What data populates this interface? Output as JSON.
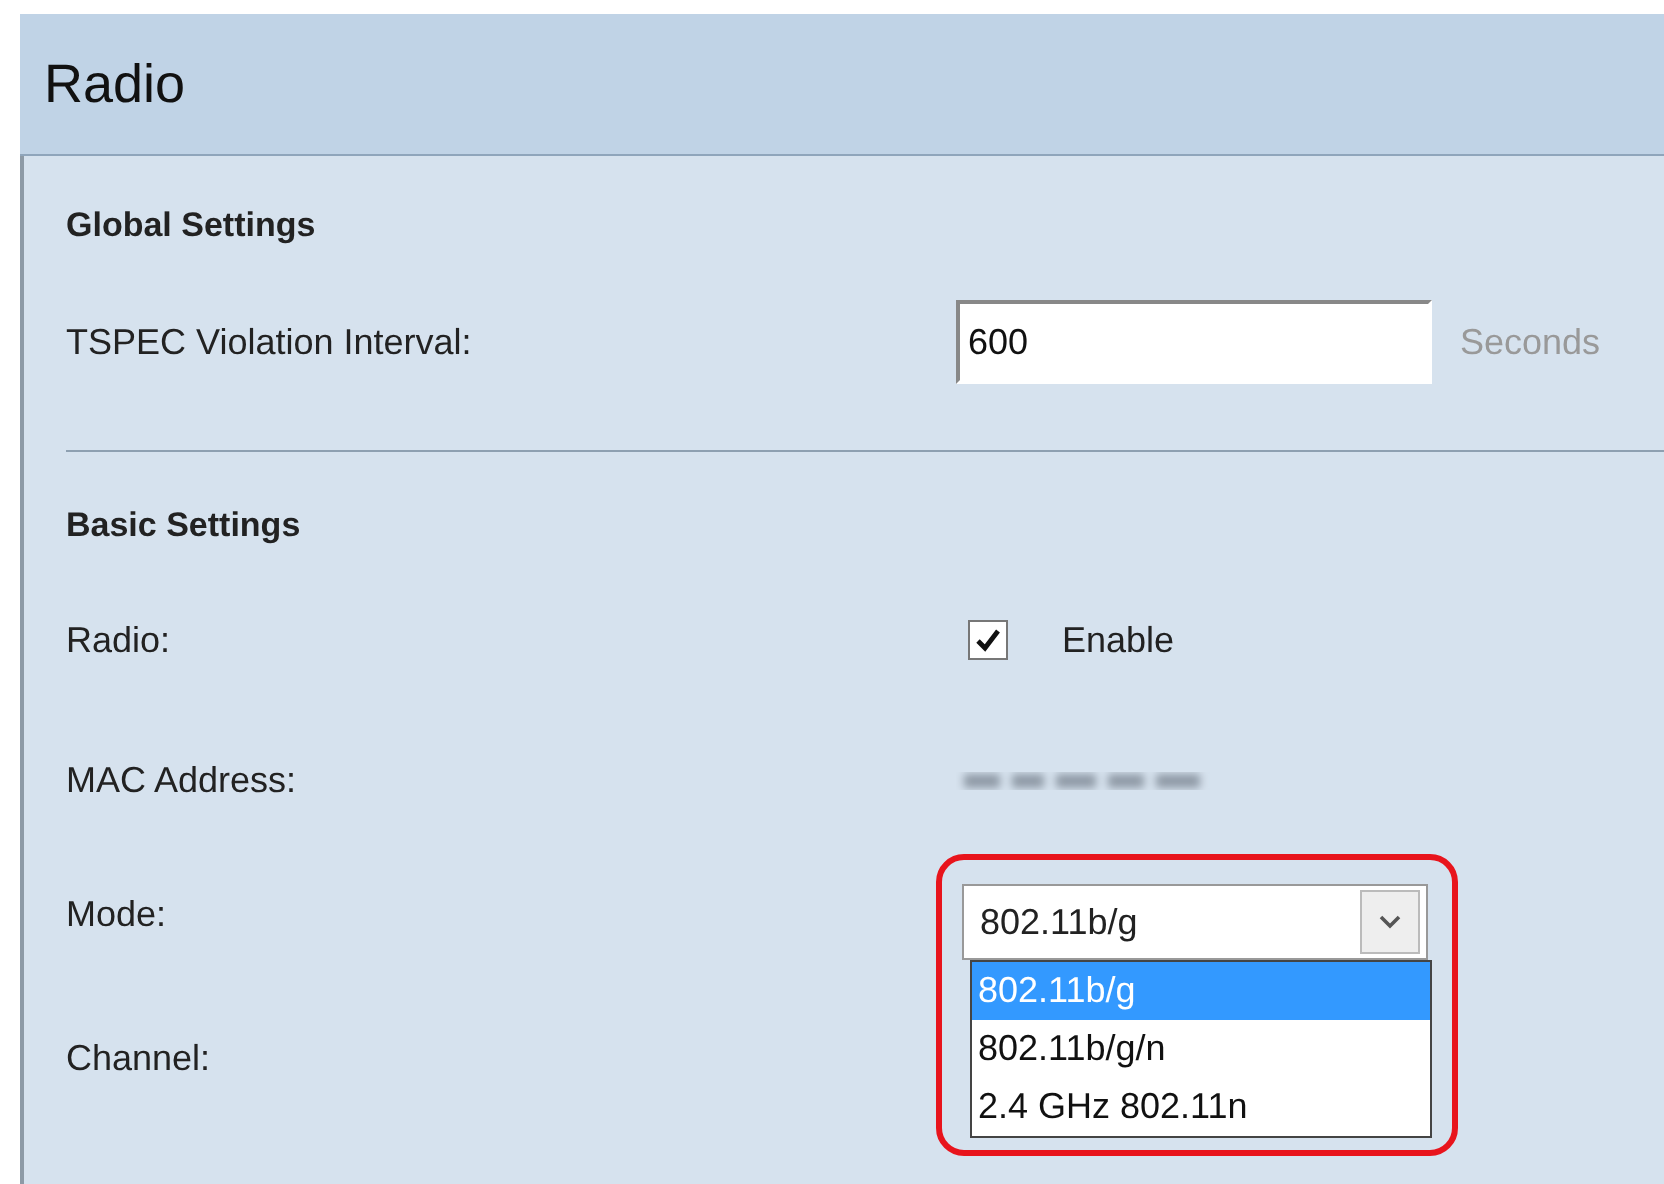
{
  "page_title": "Radio",
  "global_settings": {
    "heading": "Global Settings",
    "tspec": {
      "label": "TSPEC Violation Interval:",
      "value": "600",
      "unit": "Seconds"
    }
  },
  "basic_settings": {
    "heading": "Basic Settings",
    "radio": {
      "label": "Radio:",
      "checked": true,
      "option": "Enable"
    },
    "mac": {
      "label": "MAC Address:"
    },
    "mode": {
      "label": "Mode:",
      "value": "802.11b/g",
      "expanded": true,
      "highlighted": true,
      "options": [
        {
          "label": "802.11b/g",
          "selected": true
        },
        {
          "label": "802.11b/g/n",
          "selected": false
        },
        {
          "label": "2.4 GHz 802.11n",
          "selected": false
        }
      ]
    },
    "channel": {
      "label": "Channel:"
    }
  }
}
